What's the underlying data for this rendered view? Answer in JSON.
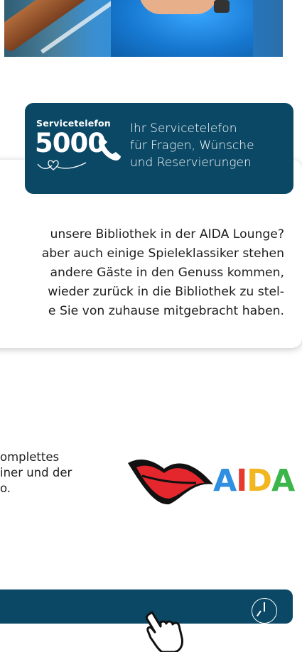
{
  "service": {
    "label": "Servicetelefon",
    "number": "5000",
    "lines": [
      "Ihr Servicetelefon",
      "für Fragen, Wünsche",
      "und Reservierungen"
    ]
  },
  "library_text": {
    "lines": [
      "unsere Bibliothek in der AIDA Lounge?",
      "aber auch einige Spieleklassiker stehen",
      "andere Gäste in den Genuss kommen,",
      "wieder zurück in die Bibliothek zu stel-",
      "e Sie von zuhause mitgebracht haben."
    ]
  },
  "partial_text": {
    "lines": [
      "omplettes",
      "iner und der",
      "",
      "o."
    ]
  },
  "logo": {
    "letters": [
      "A",
      "I",
      "D",
      "A"
    ]
  },
  "colors": {
    "navy": "#0a4865",
    "aida_blue": "#2f8fe0",
    "aida_red": "#e63a2f",
    "aida_yellow": "#f2b620",
    "aida_green": "#3cb54a"
  },
  "icons": {
    "clock": "clock-icon",
    "cursor": "hand-pointer-icon",
    "phone": "phone-icon"
  }
}
